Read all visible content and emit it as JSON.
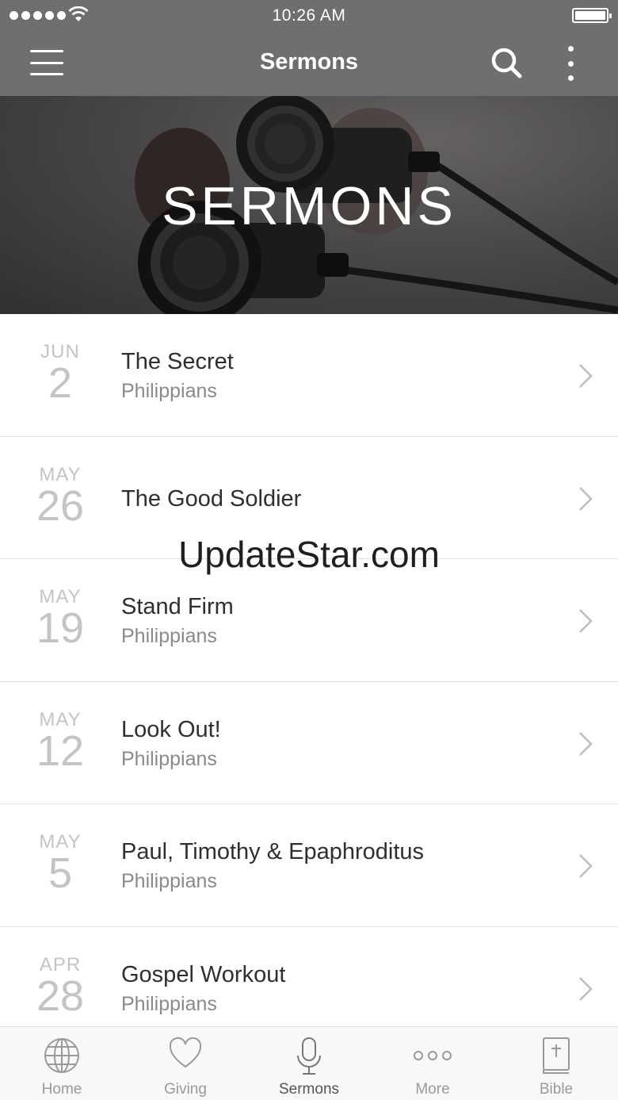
{
  "status_bar": {
    "time": "10:26 AM",
    "signal_bars": 5
  },
  "app_bar": {
    "title": "Sermons"
  },
  "hero": {
    "title": "SERMONS"
  },
  "sermons": [
    {
      "month": "JUN",
      "day": "2",
      "title": "The Secret",
      "series": "Philippians"
    },
    {
      "month": "MAY",
      "day": "26",
      "title": "The Good Soldier",
      "series": ""
    },
    {
      "month": "MAY",
      "day": "19",
      "title": "Stand Firm",
      "series": "Philippians"
    },
    {
      "month": "MAY",
      "day": "12",
      "title": "Look Out!",
      "series": "Philippians"
    },
    {
      "month": "MAY",
      "day": "5",
      "title": "Paul, Timothy & Epaphroditus",
      "series": "Philippians"
    },
    {
      "month": "APR",
      "day": "28",
      "title": "Gospel Workout",
      "series": "Philippians"
    }
  ],
  "watermark": "UpdateStar.com",
  "tabs": [
    {
      "label": "Home",
      "icon": "globe-icon"
    },
    {
      "label": "Giving",
      "icon": "heart-icon"
    },
    {
      "label": "Sermons",
      "icon": "microphone-icon",
      "active": true
    },
    {
      "label": "More",
      "icon": "more-dots-icon"
    },
    {
      "label": "Bible",
      "icon": "bible-icon"
    }
  ],
  "colors": {
    "app_bar": "#6f6f6f",
    "date_text": "#c4c4c4",
    "title_text": "#2f2f2f",
    "series_text": "#8a8a8a",
    "tab_inactive": "#9a9a9a"
  }
}
